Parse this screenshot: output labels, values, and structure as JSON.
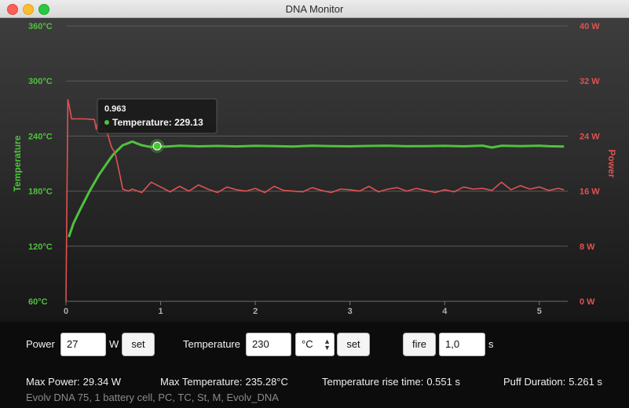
{
  "window": {
    "title": "DNA Monitor"
  },
  "chart_data": {
    "type": "line",
    "x_ticks": [
      "0",
      "1",
      "2",
      "3",
      "4",
      "5"
    ],
    "xlim": [
      0,
      5.3
    ],
    "y_left": {
      "label": "Temperature",
      "ticks": [
        "60°C",
        "120°C",
        "180°C",
        "240°C",
        "300°C",
        "360°C"
      ],
      "range": [
        60,
        360
      ]
    },
    "y_right": {
      "label": "Power",
      "ticks": [
        "0 W",
        "8 W",
        "16 W",
        "24 W",
        "32 W",
        "40 W"
      ],
      "range": [
        0,
        40
      ]
    },
    "grid": true,
    "series": [
      {
        "name": "Temperature",
        "color": "#4fc23d",
        "axis": "left",
        "x": [
          0.03,
          0.08,
          0.15,
          0.25,
          0.35,
          0.45,
          0.5,
          0.55,
          0.6,
          0.65,
          0.7,
          0.75,
          0.8,
          0.85,
          0.9,
          0.963,
          1.05,
          1.2,
          1.4,
          1.6,
          1.8,
          2.0,
          2.2,
          2.4,
          2.6,
          2.8,
          3.0,
          3.2,
          3.4,
          3.6,
          3.8,
          4.0,
          4.2,
          4.4,
          4.5,
          4.6,
          4.8,
          5.0,
          5.1,
          5.26
        ],
        "y": [
          130,
          145,
          160,
          180,
          198,
          213,
          220,
          225,
          230,
          232,
          234,
          232,
          230,
          229,
          228,
          229.13,
          228.5,
          229.5,
          228.8,
          229.2,
          228.7,
          229.3,
          229,
          228.6,
          229.4,
          229,
          228.8,
          229.2,
          229.5,
          228.9,
          229.1,
          229.3,
          228.8,
          229.6,
          227.5,
          229.4,
          229,
          229.5,
          228.9,
          228.6
        ]
      },
      {
        "name": "Power",
        "color": "#e05251",
        "axis": "right",
        "x": [
          0.0,
          0.02,
          0.04,
          0.06,
          0.08,
          0.1,
          0.2,
          0.3,
          0.32,
          0.34,
          0.36,
          0.4,
          0.44,
          0.48,
          0.52,
          0.56,
          0.6,
          0.66,
          0.7,
          0.8,
          0.9,
          1.0,
          1.1,
          1.2,
          1.3,
          1.4,
          1.5,
          1.6,
          1.7,
          1.8,
          1.9,
          2.0,
          2.1,
          2.2,
          2.3,
          2.4,
          2.5,
          2.6,
          2.7,
          2.8,
          2.9,
          3.0,
          3.1,
          3.2,
          3.3,
          3.4,
          3.5,
          3.6,
          3.7,
          3.8,
          3.9,
          4.0,
          4.1,
          4.2,
          4.3,
          4.4,
          4.5,
          4.6,
          4.7,
          4.8,
          4.9,
          5.0,
          5.1,
          5.2,
          5.26
        ],
        "y": [
          0,
          29.3,
          28,
          26.5,
          26.5,
          26.5,
          26.5,
          26.4,
          25,
          26.4,
          24.8,
          25.2,
          24.3,
          22.4,
          21.5,
          19,
          16.3,
          16,
          16.3,
          15.8,
          17.3,
          16.6,
          15.9,
          16.7,
          16,
          16.9,
          16.3,
          15.8,
          16.6,
          16.2,
          16,
          16.4,
          15.8,
          16.7,
          16.1,
          16,
          15.9,
          16.5,
          16.1,
          15.8,
          16.3,
          16.2,
          16,
          16.7,
          15.9,
          16.3,
          16.5,
          16,
          16.4,
          16.1,
          15.8,
          16.2,
          15.9,
          16.6,
          16.3,
          16.4,
          16.1,
          17.3,
          16.2,
          16.8,
          16.3,
          16.6,
          16.1,
          16.4,
          16.2
        ]
      }
    ],
    "tooltip": {
      "x_label": "0.963",
      "series_label": "Temperature:",
      "value": "229.13"
    }
  },
  "controls": {
    "power_label": "Power",
    "power_value": "27",
    "power_unit": "W",
    "power_set": "set",
    "temp_label": "Temperature",
    "temp_value": "230",
    "temp_unit": "°C",
    "temp_set": "set",
    "fire_label": "fire",
    "fire_value": "1,0",
    "fire_unit": "s"
  },
  "stats": {
    "max_power_label": "Max Power:",
    "max_power_value": "29.34 W",
    "max_temp_label": "Max Temperature:",
    "max_temp_value": "235.28°C",
    "rise_label": "Temperature rise time:",
    "rise_value": "0.551 s",
    "puff_label": "Puff Duration:",
    "puff_value": "5.261 s"
  },
  "device_info": "Evolv DNA 75, 1 battery cell, PC, TC, St, M, Evolv_DNA"
}
